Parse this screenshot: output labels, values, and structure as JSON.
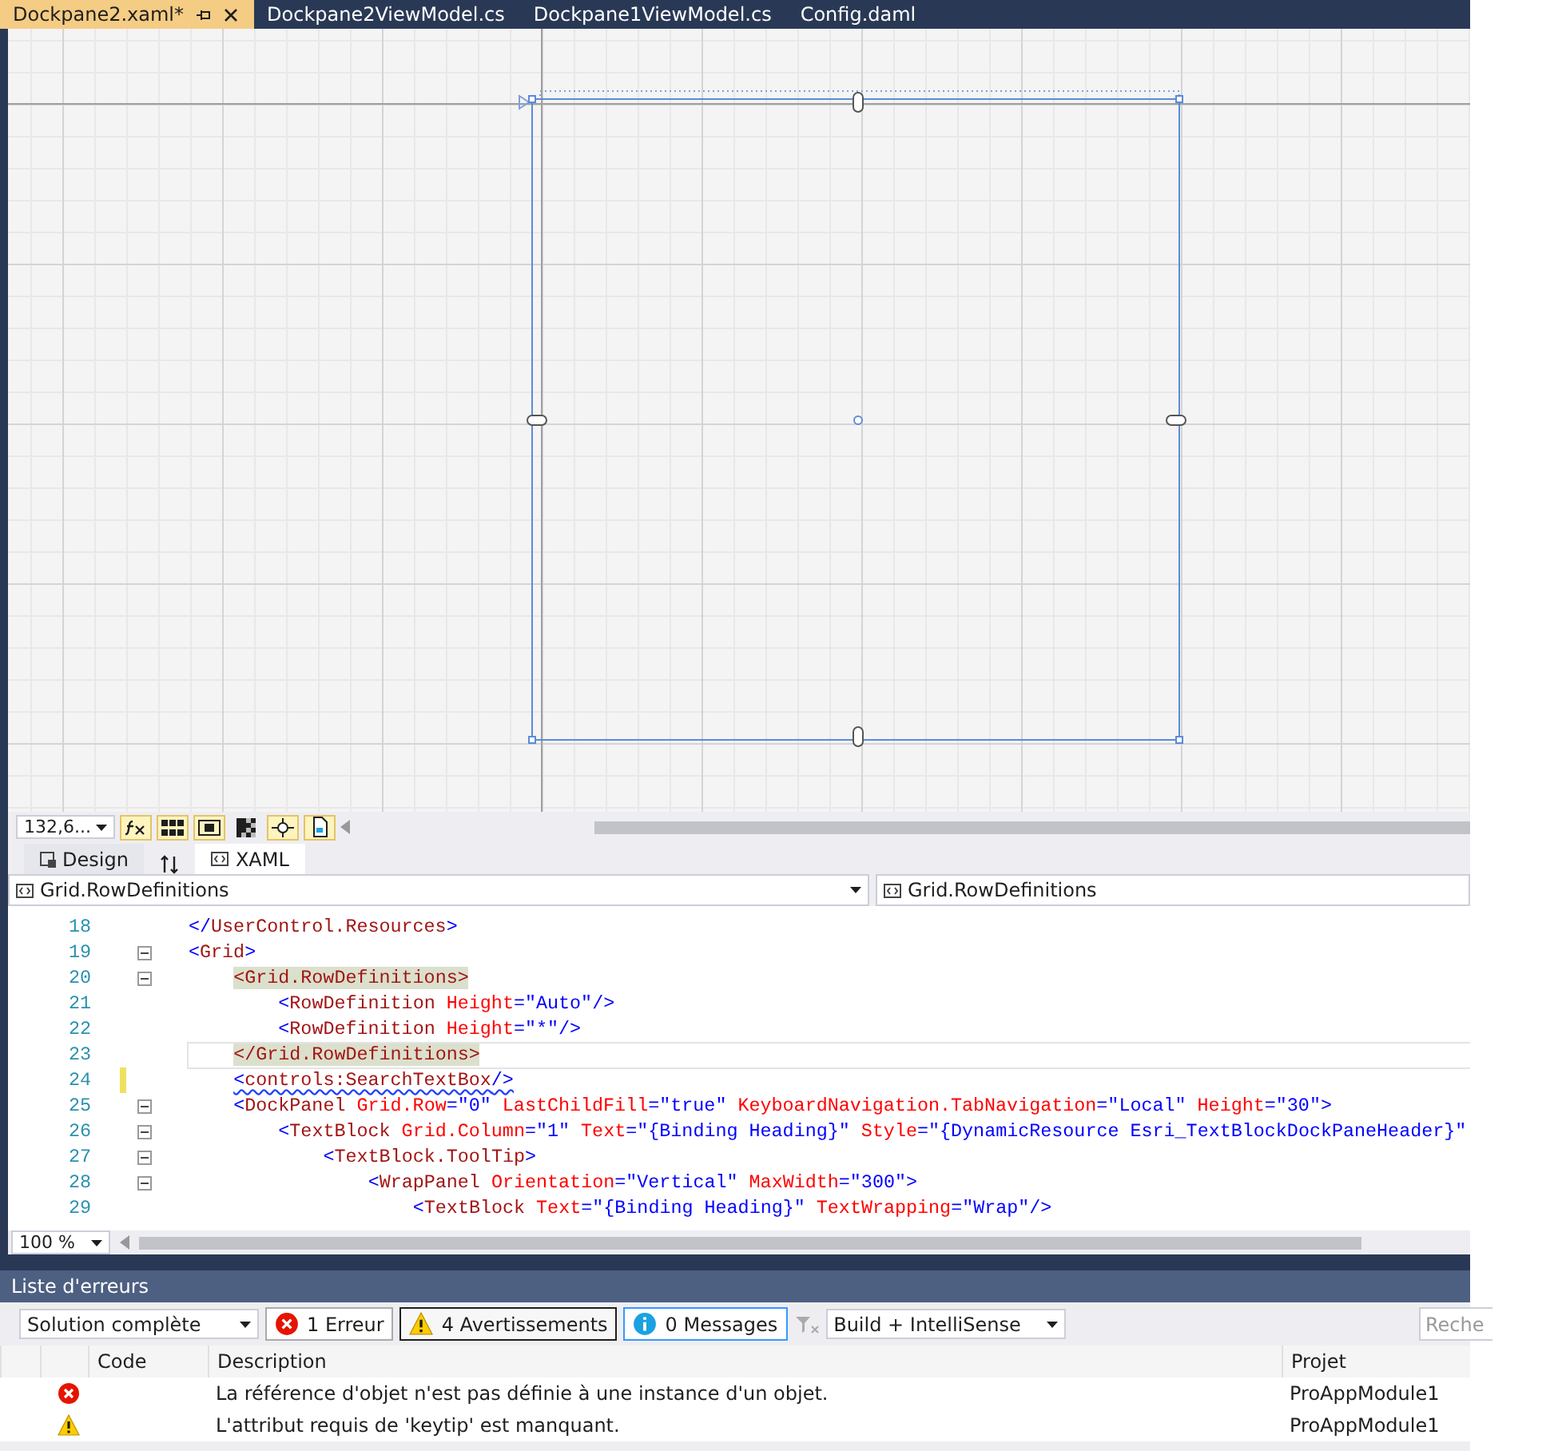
{
  "tabs": [
    {
      "label": "Dockpane2.xaml*",
      "selected": true
    },
    {
      "label": "Dockpane2ViewModel.cs",
      "selected": false
    },
    {
      "label": "Dockpane1ViewModel.cs",
      "selected": false
    },
    {
      "label": "Config.daml",
      "selected": false
    }
  ],
  "designer_toolbar": {
    "zoom": "132,6..."
  },
  "view_tabs": [
    {
      "label": "Design",
      "selected": false
    },
    {
      "label": "XAML",
      "selected": true
    }
  ],
  "nav_bar": {
    "left": "Grid.RowDefinitions",
    "right": "Grid.RowDefinitions"
  },
  "code_lines": [
    {
      "number": "18",
      "fold": false,
      "changed": false,
      "current": false,
      "squiggle": false,
      "tokens": [
        {
          "kind": "bracket",
          "text": "</"
        },
        {
          "kind": "element",
          "text": "UserControl.Resources"
        },
        {
          "kind": "bracket",
          "text": ">"
        }
      ]
    },
    {
      "number": "19",
      "fold": true,
      "changed": false,
      "current": false,
      "squiggle": false,
      "tokens": [
        {
          "kind": "bracket",
          "text": "<"
        },
        {
          "kind": "element",
          "text": "Grid"
        },
        {
          "kind": "bracket",
          "text": ">"
        }
      ],
      "children": [
        {
          "number": "20",
          "fold": true,
          "changed": false,
          "current": false,
          "squiggle": false,
          "tokens": [
            {
              "kind": "match",
              "text": "<Grid.RowDefinitions>"
            }
          ],
          "children": [
            {
              "number": "21",
              "fold": false,
              "changed": false,
              "current": false,
              "squiggle": false,
              "tokens": [
                {
                  "kind": "bracket",
                  "text": "<"
                },
                {
                  "kind": "element",
                  "text": "RowDefinition"
                },
                {
                  "kind": "attr",
                  "text": " Height"
                },
                {
                  "kind": "bracket",
                  "text": "=\"Auto\"/>"
                }
              ]
            },
            {
              "number": "22",
              "fold": false,
              "changed": false,
              "current": false,
              "squiggle": false,
              "tokens": [
                {
                  "kind": "bracket",
                  "text": "<"
                },
                {
                  "kind": "element",
                  "text": "RowDefinition"
                },
                {
                  "kind": "attr",
                  "text": " Height"
                },
                {
                  "kind": "bracket",
                  "text": "=\"*\"/>"
                }
              ]
            }
          ]
        },
        {
          "number": "23",
          "fold": false,
          "changed": false,
          "current": true,
          "squiggle": false,
          "tokens": [
            {
              "kind": "match",
              "text": "</Grid.RowDefinitions>"
            }
          ]
        },
        {
          "number": "24",
          "fold": false,
          "changed": true,
          "current": false,
          "squiggle": true,
          "tokens": [
            {
              "kind": "bracket",
              "text": "<"
            },
            {
              "kind": "element",
              "text": "controls:SearchTextBox"
            },
            {
              "kind": "bracket",
              "text": "/>"
            }
          ]
        },
        {
          "number": "25",
          "fold": true,
          "changed": false,
          "current": false,
          "squiggle": false,
          "tokens": [
            {
              "kind": "bracket",
              "text": "<"
            },
            {
              "kind": "element",
              "text": "DockPanel"
            },
            {
              "kind": "attr",
              "text": " Grid.Row"
            },
            {
              "kind": "bracket",
              "text": "=\"0\""
            },
            {
              "kind": "attr",
              "text": " LastChildFill"
            },
            {
              "kind": "bracket",
              "text": "=\"true\""
            },
            {
              "kind": "attr",
              "text": " KeyboardNavigation.TabNavigation"
            },
            {
              "kind": "bracket",
              "text": "=\"Local\""
            },
            {
              "kind": "attr",
              "text": " Height"
            },
            {
              "kind": "bracket",
              "text": "=\"30\">"
            }
          ],
          "children": [
            {
              "number": "26",
              "fold": true,
              "changed": false,
              "current": false,
              "squiggle": false,
              "tokens": [
                {
                  "kind": "bracket",
                  "text": "<"
                },
                {
                  "kind": "element",
                  "text": "TextBlock"
                },
                {
                  "kind": "attr",
                  "text": " Grid.Column"
                },
                {
                  "kind": "bracket",
                  "text": "=\"1\""
                },
                {
                  "kind": "attr",
                  "text": " Text"
                },
                {
                  "kind": "bracket",
                  "text": "=\"{Binding Heading}\""
                },
                {
                  "kind": "attr",
                  "text": " Style"
                },
                {
                  "kind": "bracket",
                  "text": "=\"{DynamicResource Esri_TextBlockDockPaneHeader}\""
                }
              ],
              "children": [
                {
                  "number": "27",
                  "fold": true,
                  "changed": false,
                  "current": false,
                  "squiggle": false,
                  "tokens": [
                    {
                      "kind": "bracket",
                      "text": "<"
                    },
                    {
                      "kind": "element",
                      "text": "TextBlock.ToolTip"
                    },
                    {
                      "kind": "bracket",
                      "text": ">"
                    }
                  ],
                  "children": [
                    {
                      "number": "28",
                      "fold": true,
                      "changed": false,
                      "current": false,
                      "squiggle": false,
                      "tokens": [
                        {
                          "kind": "bracket",
                          "text": "<"
                        },
                        {
                          "kind": "element",
                          "text": "WrapPanel"
                        },
                        {
                          "kind": "attr",
                          "text": " Orientation"
                        },
                        {
                          "kind": "bracket",
                          "text": "=\"Vertical\""
                        },
                        {
                          "kind": "attr",
                          "text": " MaxWidth"
                        },
                        {
                          "kind": "bracket",
                          "text": "=\"300\">"
                        }
                      ],
                      "children": [
                        {
                          "number": "29",
                          "fold": false,
                          "changed": false,
                          "current": false,
                          "squiggle": false,
                          "tokens": [
                            {
                              "kind": "bracket",
                              "text": "<"
                            },
                            {
                              "kind": "element",
                              "text": "TextBlock"
                            },
                            {
                              "kind": "attr",
                              "text": " Text"
                            },
                            {
                              "kind": "bracket",
                              "text": "=\"{Binding Heading}\""
                            },
                            {
                              "kind": "attr",
                              "text": " TextWrapping"
                            },
                            {
                              "kind": "bracket",
                              "text": "=\"Wrap\"/>"
                            }
                          ]
                        }
                      ]
                    }
                  ]
                }
              ]
            }
          ]
        }
      ]
    }
  ],
  "editor_zoom": "100 %",
  "error_list": {
    "title": "Liste d'erreurs",
    "scope": "Solution complète",
    "filters": [
      {
        "kind": "error",
        "label": "1 Erreur",
        "selected": true
      },
      {
        "kind": "warning",
        "label": "4 Avertissements",
        "selected": true
      },
      {
        "kind": "info",
        "label": "0 Messages",
        "selected": true
      }
    ],
    "source": "Build + IntelliSense",
    "search": {
      "placeholder": "Reche"
    },
    "columns": [
      "Code",
      "Description",
      "Projet"
    ],
    "rows": [
      {
        "kind": "error",
        "description": "La référence d'objet n'est pas définie à une instance d'un objet.",
        "project": "ProAppModule1"
      },
      {
        "kind": "warning",
        "description": "L'attribut requis de 'keytip' est manquant.",
        "project": "ProAppModule1"
      }
    ]
  }
}
